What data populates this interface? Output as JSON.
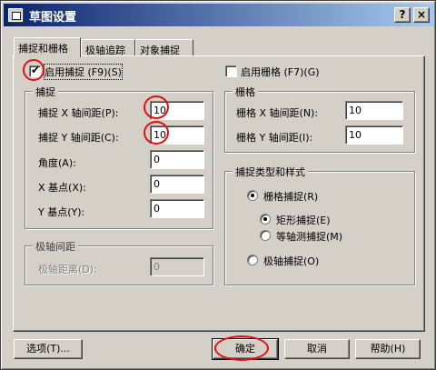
{
  "window": {
    "title": "草图设置",
    "help_glyph": "?",
    "close_glyph": "×"
  },
  "tabs": [
    {
      "label": "捕捉和栅格",
      "active": true
    },
    {
      "label": "极轴追踪",
      "active": false
    },
    {
      "label": "对象捕捉",
      "active": false
    }
  ],
  "snap": {
    "enable_label": "启用捕捉 (F9)(S)",
    "enabled": true,
    "group_title": "捕捉",
    "x_label": "捕捉 X 轴间距(P):",
    "x_value": "10",
    "y_label": "捕捉 Y 轴间距(C):",
    "y_value": "10",
    "angle_label": "角度(A):",
    "angle_value": "0",
    "xbase_label": "X 基点(X):",
    "xbase_value": "0",
    "ybase_label": "Y 基点(Y):",
    "ybase_value": "0"
  },
  "polar": {
    "group_title": "极轴间距",
    "distance_label": "极轴距离(D):",
    "distance_value": "0"
  },
  "grid": {
    "enable_label": "启用栅格 (F7)(G)",
    "enabled": false,
    "group_title": "栅格",
    "x_label": "栅格 X 轴间距(N):",
    "x_value": "10",
    "y_label": "栅格 Y 轴间距(I):",
    "y_value": "10"
  },
  "snap_type": {
    "group_title": "捕捉类型和样式",
    "grid_snap": "栅格捕捉(R)",
    "rect_snap": "矩形捕捉(E)",
    "iso_snap": "等轴测捕捉(M)",
    "polar_snap": "极轴捕捉(O)",
    "selected_main": "grid",
    "selected_sub": "rect"
  },
  "buttons": {
    "options": "选项(T)...",
    "ok": "确定",
    "cancel": "取消",
    "help": "帮助(H)"
  },
  "colors": {
    "annotation": "#e01010",
    "titlebar_start": "#0a246a",
    "face": "#d4d0c8"
  }
}
